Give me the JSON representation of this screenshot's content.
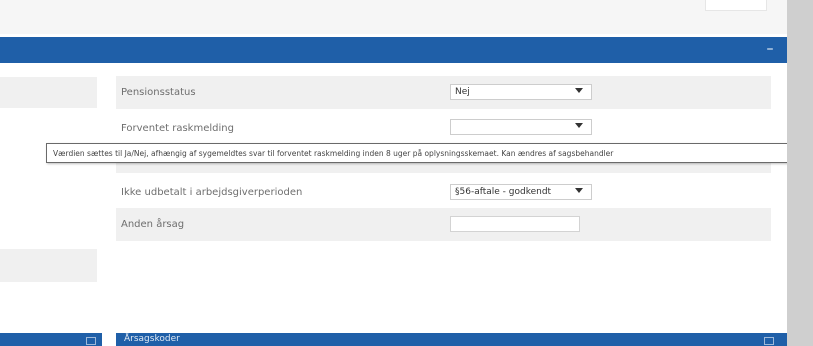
{
  "panel": {
    "collapse_label": "–"
  },
  "form": {
    "pensionsstatus": {
      "label": "Pensionsstatus",
      "value": "Nej"
    },
    "forventet": {
      "label": "Forventet raskmelding",
      "value": ""
    },
    "ikke_udbetalt": {
      "label": "Ikke udbetalt i arbejdsgiverperioden",
      "value": "§56-aftale - godkendt"
    },
    "anden_aarsag": {
      "label": "Anden årsag",
      "value": ""
    }
  },
  "tooltip": {
    "text": "Værdien sættes til Ja/Nej, afhængig af sygemeldtes svar til forventet raskmelding inden 8 uger på oplysningsskemaet. Kan ændres af sagsbehandler"
  },
  "bottom_panel": {
    "title": "Årsagskoder"
  }
}
